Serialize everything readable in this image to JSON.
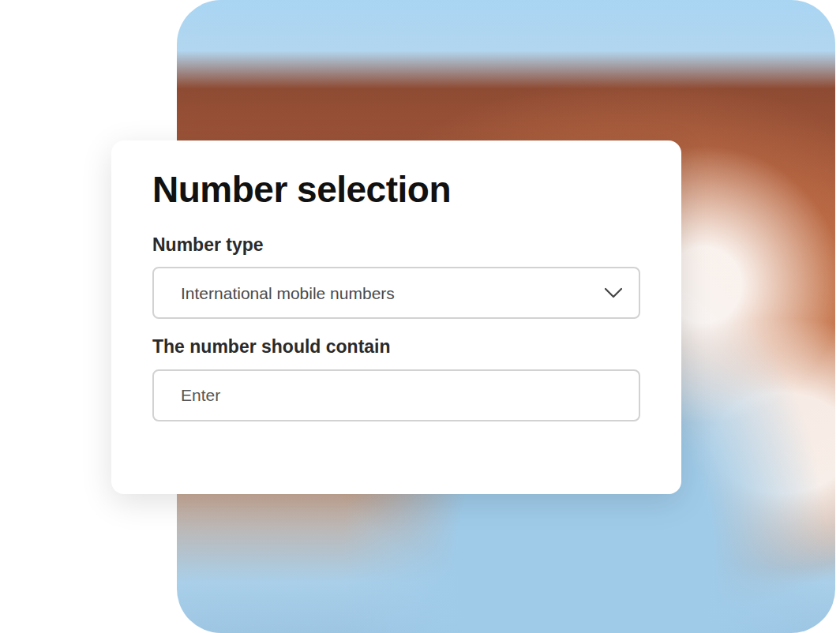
{
  "card": {
    "title": "Number selection",
    "fields": [
      {
        "kind": "select",
        "label": "Number type",
        "value": "International mobile numbers"
      },
      {
        "kind": "input",
        "label": "The number should contain",
        "placeholder": "Enter"
      }
    ]
  }
}
